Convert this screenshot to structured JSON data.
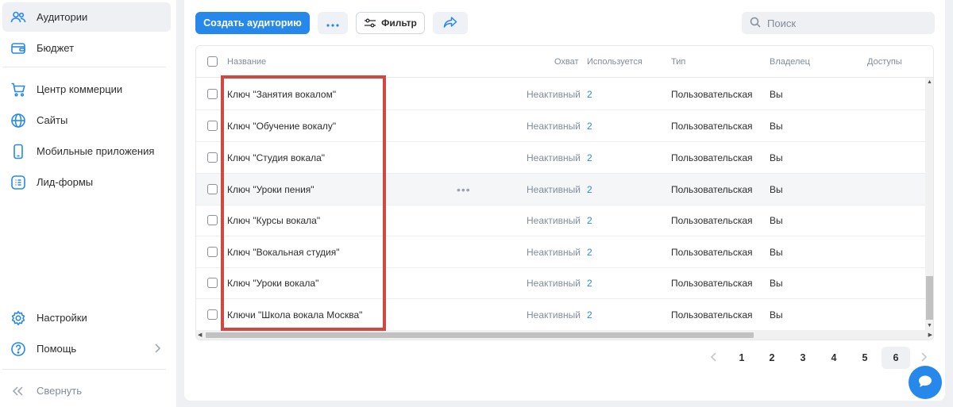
{
  "sidebar": {
    "items": [
      {
        "label": "Аудитории",
        "icon": "users-icon"
      },
      {
        "label": "Бюджет",
        "icon": "wallet-icon"
      },
      {
        "label": "Центр коммерции",
        "icon": "cart-icon"
      },
      {
        "label": "Сайты",
        "icon": "globe-icon"
      },
      {
        "label": "Мобильные приложения",
        "icon": "phone-icon"
      },
      {
        "label": "Лид-формы",
        "icon": "list-form-icon"
      }
    ],
    "settings": "Настройки",
    "help": "Помощь",
    "collapse": "Свернуть"
  },
  "toolbar": {
    "create_label": "Создать аудиторию",
    "filter_label": "Фильтр",
    "search_placeholder": "Поиск"
  },
  "table": {
    "headers": {
      "name": "Название",
      "reach": "Охват",
      "used": "Используется",
      "type": "Тип",
      "owner": "Владелец",
      "access": "Доступы"
    },
    "rows": [
      {
        "name": "Ключ \"Занятия вокалом\"",
        "reach": "Неактивный",
        "used": "2",
        "type": "Пользовательская",
        "owner": "Вы"
      },
      {
        "name": "Ключ \"Обучение вокалу\"",
        "reach": "Неактивный",
        "used": "2",
        "type": "Пользовательская",
        "owner": "Вы"
      },
      {
        "name": "Ключ \"Студия вокала\"",
        "reach": "Неактивный",
        "used": "2",
        "type": "Пользовательская",
        "owner": "Вы"
      },
      {
        "name": "Ключ \"Уроки пения\"",
        "reach": "Неактивный",
        "used": "2",
        "type": "Пользовательская",
        "owner": "Вы"
      },
      {
        "name": "Ключ \"Курсы вокала\"",
        "reach": "Неактивный",
        "used": "2",
        "type": "Пользовательская",
        "owner": "Вы"
      },
      {
        "name": "Ключ \"Вокальная студия\"",
        "reach": "Неактивный",
        "used": "2",
        "type": "Пользовательская",
        "owner": "Вы"
      },
      {
        "name": "Ключ \"Уроки вокала\"",
        "reach": "Неактивный",
        "used": "2",
        "type": "Пользовательская",
        "owner": "Вы"
      },
      {
        "name": "Ключи \"Школа вокала Москва\"",
        "reach": "Неактивный",
        "used": "2",
        "type": "Пользовательская",
        "owner": "Вы"
      }
    ]
  },
  "pagination": {
    "pages": [
      "1",
      "2",
      "3",
      "4",
      "5",
      "6"
    ],
    "current": "6"
  },
  "colors": {
    "accent": "#2688eb",
    "highlight": "#d0483f"
  }
}
